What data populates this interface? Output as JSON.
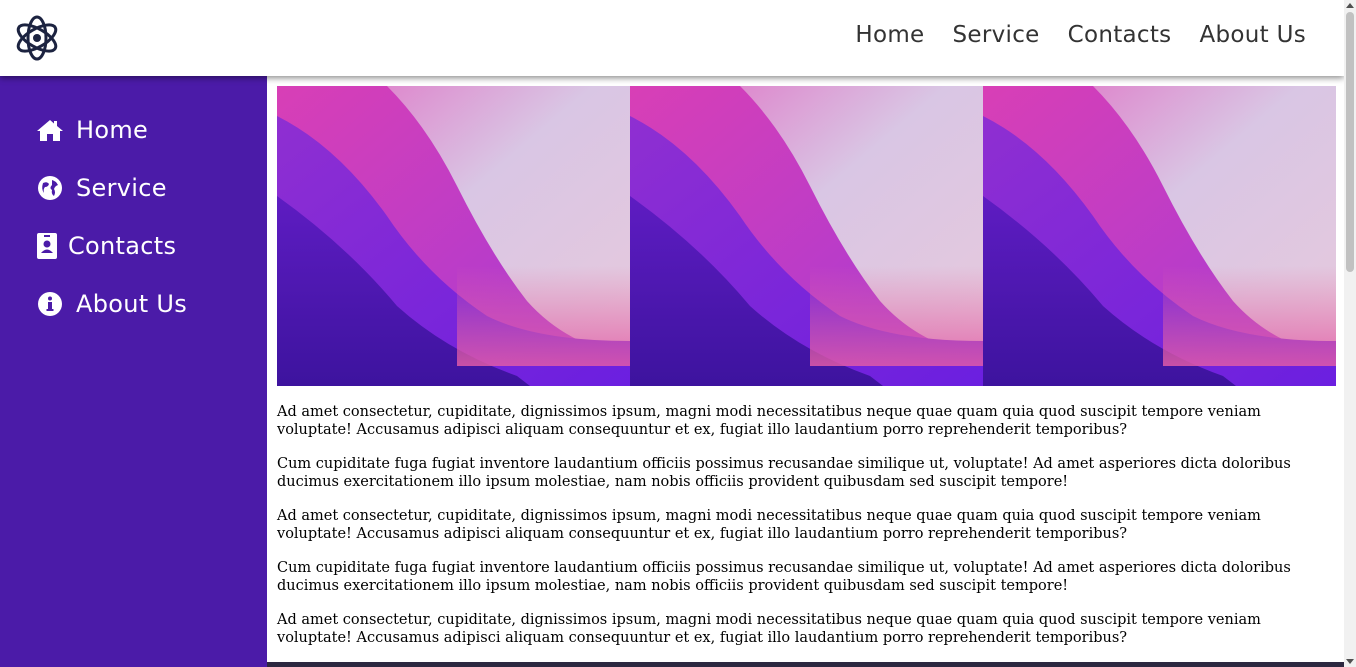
{
  "header": {
    "nav": [
      {
        "label": "Home"
      },
      {
        "label": "Service"
      },
      {
        "label": "Contacts"
      },
      {
        "label": "About Us"
      }
    ]
  },
  "sidebar": {
    "items": [
      {
        "label": "Home",
        "icon": "home-icon"
      },
      {
        "label": "Service",
        "icon": "globe-icon"
      },
      {
        "label": "Contacts",
        "icon": "contact-card-icon"
      },
      {
        "label": "About Us",
        "icon": "info-icon"
      }
    ]
  },
  "gallery": {
    "images": [
      "gradient-wallpaper",
      "gradient-wallpaper",
      "gradient-wallpaper"
    ]
  },
  "content": {
    "paragraphs": [
      "Ad amet consectetur, cupiditate, dignissimos ipsum, magni modi necessitatibus neque quae quam quia quod suscipit tempore veniam voluptate! Accusamus adipisci aliquam consequuntur et ex, fugiat illo laudantium porro reprehenderit temporibus?",
      "Cum cupiditate fuga fugiat inventore laudantium officiis possimus recusandae similique ut, voluptate! Ad amet asperiores dicta doloribus ducimus exercitationem illo ipsum molestiae, nam nobis officiis provident quibusdam sed suscipit tempore!",
      "Ad amet consectetur, cupiditate, dignissimos ipsum, magni modi necessitatibus neque quae quam quia quod suscipit tempore veniam voluptate! Accusamus adipisci aliquam consequuntur et ex, fugiat illo laudantium porro reprehenderit temporibus?",
      "Cum cupiditate fuga fugiat inventore laudantium officiis possimus recusandae similique ut, voluptate! Ad amet asperiores dicta doloribus ducimus exercitationem illo ipsum molestiae, nam nobis officiis provident quibusdam sed suscipit tempore!",
      "Ad amet consectetur, cupiditate, dignissimos ipsum, magni modi necessitatibus neque quae quam quia quod suscipit tempore veniam voluptate! Accusamus adipisci aliquam consequuntur et ex, fugiat illo laudantium porro reprehenderit temporibus?"
    ]
  },
  "colors": {
    "sidebar_bg": "#4b1ba8",
    "text": "#000000",
    "nav_text": "#333333"
  }
}
